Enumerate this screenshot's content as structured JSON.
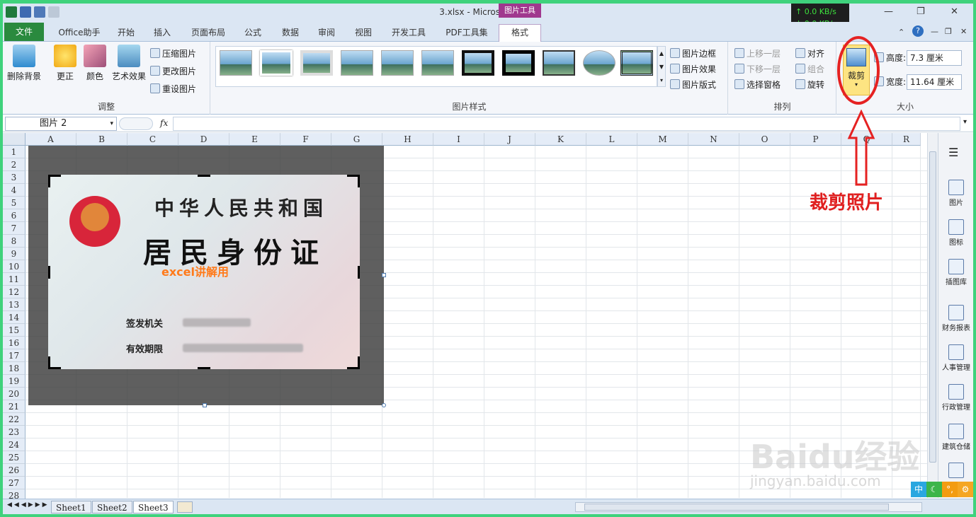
{
  "window": {
    "title": "3.xlsx - Microsoft Excel",
    "context_tab_group": "图片工具"
  },
  "network": {
    "up": "↑ 0.0 KB/s",
    "down": "↓ 0.0 KB/s"
  },
  "tabs": [
    "文件",
    "Office助手",
    "开始",
    "插入",
    "页面布局",
    "公式",
    "数据",
    "审阅",
    "视图",
    "开发工具",
    "PDF工具集",
    "格式"
  ],
  "ribbon": {
    "adjust": {
      "label": "调整",
      "remove_bg": "删除背景",
      "correct": "更正",
      "color": "颜色",
      "art": "艺术效果",
      "compress": "压缩图片",
      "change": "更改图片",
      "reset": "重设图片"
    },
    "styles": {
      "label": "图片样式",
      "border": "图片边框",
      "effects": "图片效果",
      "layout": "图片版式"
    },
    "arrange": {
      "label": "排列",
      "forward": "上移一层",
      "backward": "下移一层",
      "pane": "选择窗格",
      "align": "对齐",
      "group": "组合",
      "rotate": "旋转"
    },
    "size": {
      "label": "大小",
      "crop": "裁剪",
      "height_label": "高度:",
      "height_value": "7.3 厘米",
      "width_label": "宽度:",
      "width_value": "11.64 厘米"
    }
  },
  "formula_bar": {
    "name_box": "图片 2",
    "fx": "fx"
  },
  "columns": [
    "A",
    "B",
    "C",
    "D",
    "E",
    "F",
    "G",
    "H",
    "I",
    "J",
    "K",
    "L",
    "M",
    "N",
    "O",
    "P",
    "Q",
    "R"
  ],
  "rows": [
    "1",
    "2",
    "3",
    "4",
    "5",
    "6",
    "7",
    "8",
    "9",
    "10",
    "11",
    "12",
    "13",
    "14",
    "15",
    "16",
    "17",
    "18",
    "19",
    "20",
    "21",
    "22",
    "23",
    "24",
    "25",
    "26",
    "27",
    "28"
  ],
  "id_card": {
    "line1": "中华人民共和国",
    "line2": "居民身份证",
    "watermark": "excel讲解用",
    "issuer_label": "签发机关",
    "validity_label": "有效期限"
  },
  "right_pane": [
    "图片",
    "图标",
    "插图库",
    "财务报表",
    "人事管理",
    "行政管理",
    "建筑仓储"
  ],
  "sheets": [
    "Sheet1",
    "Sheet2",
    "Sheet3"
  ],
  "annotation": "裁剪照片",
  "watermark": {
    "brand": "Baidu经验",
    "url": "jingyan.baidu.com"
  },
  "ime": {
    "label": "中"
  }
}
